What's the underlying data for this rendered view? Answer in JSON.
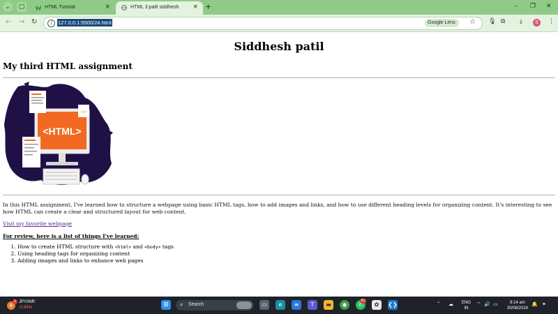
{
  "browser": {
    "tabs": [
      {
        "label": "HTML Tutorial",
        "close": "×"
      },
      {
        "label": "HTML 3:patil siddhesh",
        "close": "×"
      }
    ],
    "new_tab": "+",
    "window_controls": {
      "minimize": "–",
      "maximize": "❐",
      "close": "✕"
    },
    "url": "127.0.0.1:5500/24.html",
    "lens_label": "Google Lens",
    "profile_initial": "S",
    "accent": "#8fcb86"
  },
  "page": {
    "title": "Siddhesh patil",
    "subtitle": "My third HTML assignment",
    "image_caption": "<HTML>",
    "paragraph": "In this HTML assignment, I've learned how to structure a webpage using basic HTML tags, how to add images and links, and how to use different heading levels for organizing content. It's interesting to see how HTML can create a clear and structured layout for web content.",
    "link_text": "Visit my favorite webpage",
    "list_heading": " For review, here is a list of things I've learned:",
    "list": {
      "item1_prefix": "How to create HTML structure with ",
      "item1_code1": "<html>",
      "item1_mid": " and ",
      "item1_code2": "<body>",
      "item1_suffix": " tags",
      "item2": "Using heading tags for organizing content",
      "item3": "Adding images and links to enhance web pages"
    }
  },
  "taskbar": {
    "stock_name": "JPY/INR",
    "stock_change": "-0.64%",
    "stock_badge": "1",
    "search_label": "Search",
    "whatsapp_badge": "61",
    "lang_line1": "ENG",
    "lang_line2": "IN",
    "time": "8:14 am",
    "date": "30/08/2024"
  }
}
